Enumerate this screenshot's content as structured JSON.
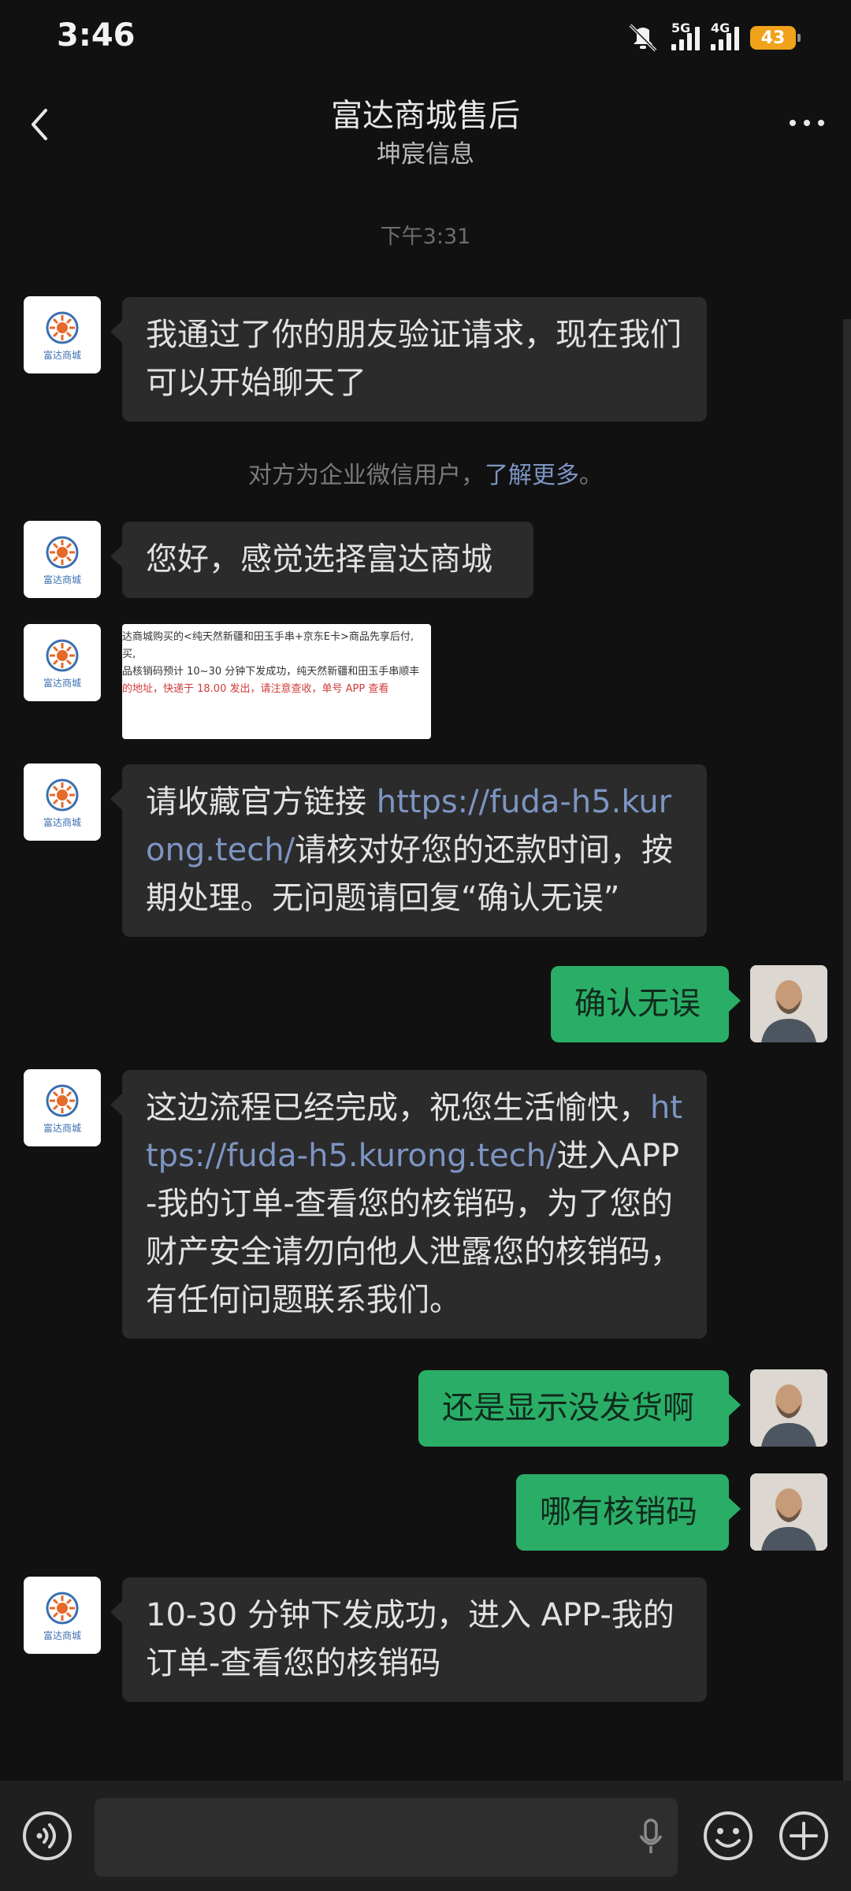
{
  "status_bar": {
    "time": "3:46",
    "net1": "5G",
    "net2": "4G",
    "battery": "43"
  },
  "header": {
    "title": "富达商城售后",
    "subtitle": "坤宸信息"
  },
  "chat": {
    "timestamp": "下午3:31",
    "msg1": "我通过了你的朋友验证请求，现在我们可以开始聊天了",
    "system_text": "对方为企业微信用户，",
    "system_link": "了解更多",
    "system_end": "。",
    "msg2": "您好，感觉选择富达商城",
    "image_lines": [
      "达商城购买的<纯天然新疆和田玉手串+京东E卡>商品先享后付,",
      "买,",
      "品核销码预计 10~30 分钟下发成功，纯天然新疆和田玉手串顺丰",
      "的地址，快递于 18.00 发出，请注意查收，单号 APP 查看"
    ],
    "msg3_a": "请收藏官方链接 ",
    "msg3_url": "https://fuda-h5.kurong.tech/",
    "msg3_b": "请核对好您的还款时间，按期处理。无问题请回复“确认无误”",
    "reply1": "确认无误",
    "msg4_a": "这边流程已经完成，祝您生活愉快，",
    "msg4_url": "https://fuda-h5.kurong.tech/",
    "msg4_b": "进入APP-我的订单-查看您的核销码，为了您的财产安全请勿向他人泄露您的核销码，有任何问题联系我们。",
    "reply2": "还是显示没发货啊",
    "reply3": "哪有核销码",
    "msg5": "10-30 分钟下发成功，进入 APP-我的订单-查看您的核销码"
  },
  "avatar_store_text": "富达商城",
  "colors": {
    "background": "#111111",
    "incoming_bubble": "#2b2b2b",
    "outgoing_bubble": "#2aae67",
    "link": "#7d95c3",
    "battery": "#f0a21a"
  }
}
